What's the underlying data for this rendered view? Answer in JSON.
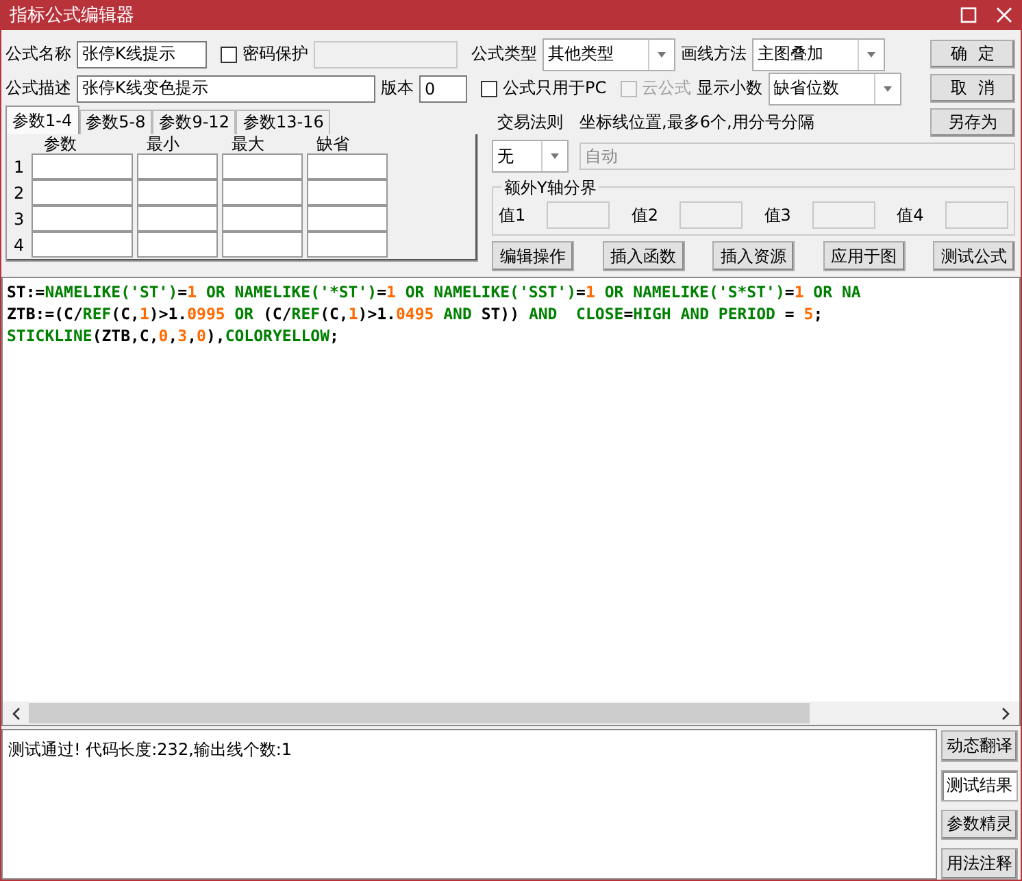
{
  "window": {
    "title": "指标公式编辑器"
  },
  "row1": {
    "name_label": "公式名称",
    "name_value": "张停K线提示",
    "password": {
      "label": "密码保护",
      "checked": false
    },
    "type_label": "公式类型",
    "type_value": "其他类型",
    "draw_label": "画线方法",
    "draw_value": "主图叠加",
    "ok": "确  定"
  },
  "row2": {
    "desc_label": "公式描述",
    "desc_value": "张停K线变色提示",
    "version_label": "版本",
    "version_value": "0",
    "pc_only": {
      "label": "公式只用于PC",
      "checked": false,
      "disabled": false
    },
    "cloud": {
      "label": "云公式",
      "checked": false,
      "disabled": true
    },
    "decimals_label": "显示小数",
    "decimals_value": "缺省位数",
    "cancel": "取  消"
  },
  "param_tabs": [
    {
      "label": "参数1-4",
      "selected": true
    },
    {
      "label": "参数5-8",
      "selected": false
    },
    {
      "label": "参数9-12",
      "selected": false
    },
    {
      "label": "参数13-16",
      "selected": false
    }
  ],
  "param_columns": [
    "参数",
    "最小",
    "最大",
    "缺省"
  ],
  "param_rows": [
    "1",
    "2",
    "3",
    "4"
  ],
  "trade_rule": {
    "label": "交易法则",
    "value": "无"
  },
  "axis": {
    "label": "坐标线位置,最多6个,用分号分隔",
    "placeholder": "自动"
  },
  "save_as": "另存为",
  "y_bounds": {
    "title": "额外Y轴分界",
    "values": [
      "值1",
      "值2",
      "值3",
      "值4"
    ]
  },
  "actions": [
    "编辑操作",
    "插入函数",
    "插入资源",
    "应用于图",
    "测试公式"
  ],
  "code": [
    [
      {
        "kind": "plain",
        "text": "ST:="
      },
      {
        "kind": "keyword",
        "text": "NAMELIKE('ST')"
      },
      {
        "kind": "plain",
        "text": "="
      },
      {
        "kind": "number",
        "text": "1"
      },
      {
        "kind": "keyword",
        "text": " OR NAMELIKE('*ST')"
      },
      {
        "kind": "plain",
        "text": "="
      },
      {
        "kind": "number",
        "text": "1"
      },
      {
        "kind": "keyword",
        "text": " OR NAMELIKE('SST')"
      },
      {
        "kind": "plain",
        "text": "="
      },
      {
        "kind": "number",
        "text": "1"
      },
      {
        "kind": "keyword",
        "text": " OR NAMELIKE('S*ST')"
      },
      {
        "kind": "plain",
        "text": "="
      },
      {
        "kind": "number",
        "text": "1"
      },
      {
        "kind": "keyword",
        "text": " OR NA"
      }
    ],
    [
      {
        "kind": "plain",
        "text": "ZTB:=(C/"
      },
      {
        "kind": "keyword",
        "text": "REF"
      },
      {
        "kind": "plain",
        "text": "(C,"
      },
      {
        "kind": "number",
        "text": "1"
      },
      {
        "kind": "plain",
        "text": ")>1."
      },
      {
        "kind": "number",
        "text": "0995"
      },
      {
        "kind": "keyword",
        "text": " OR "
      },
      {
        "kind": "plain",
        "text": "(C/"
      },
      {
        "kind": "keyword",
        "text": "REF"
      },
      {
        "kind": "plain",
        "text": "(C,"
      },
      {
        "kind": "number",
        "text": "1"
      },
      {
        "kind": "plain",
        "text": ")>1."
      },
      {
        "kind": "number",
        "text": "0495"
      },
      {
        "kind": "keyword",
        "text": " AND "
      },
      {
        "kind": "plain",
        "text": "ST)) "
      },
      {
        "kind": "keyword",
        "text": "AND  CLOSE"
      },
      {
        "kind": "plain",
        "text": "="
      },
      {
        "kind": "keyword",
        "text": "HIGH AND PERIOD"
      },
      {
        "kind": "plain",
        "text": " = "
      },
      {
        "kind": "number",
        "text": "5"
      },
      {
        "kind": "plain",
        "text": ";"
      }
    ],
    [
      {
        "kind": "keyword",
        "text": "STICKLINE"
      },
      {
        "kind": "plain",
        "text": "(ZTB,C,"
      },
      {
        "kind": "number",
        "text": "0"
      },
      {
        "kind": "plain",
        "text": ","
      },
      {
        "kind": "number",
        "text": "3"
      },
      {
        "kind": "plain",
        "text": ","
      },
      {
        "kind": "number",
        "text": "0"
      },
      {
        "kind": "plain",
        "text": "),"
      },
      {
        "kind": "keyword",
        "text": "COLORYELLOW"
      },
      {
        "kind": "plain",
        "text": ";"
      }
    ]
  ],
  "output": "测试通过! 代码长度:232,输出线个数:1",
  "side_tabs": [
    {
      "label": "动态翻译",
      "selected": false
    },
    {
      "label": "测试结果",
      "selected": true
    },
    {
      "label": "参数精灵",
      "selected": false
    },
    {
      "label": "用法注释",
      "selected": false
    }
  ]
}
